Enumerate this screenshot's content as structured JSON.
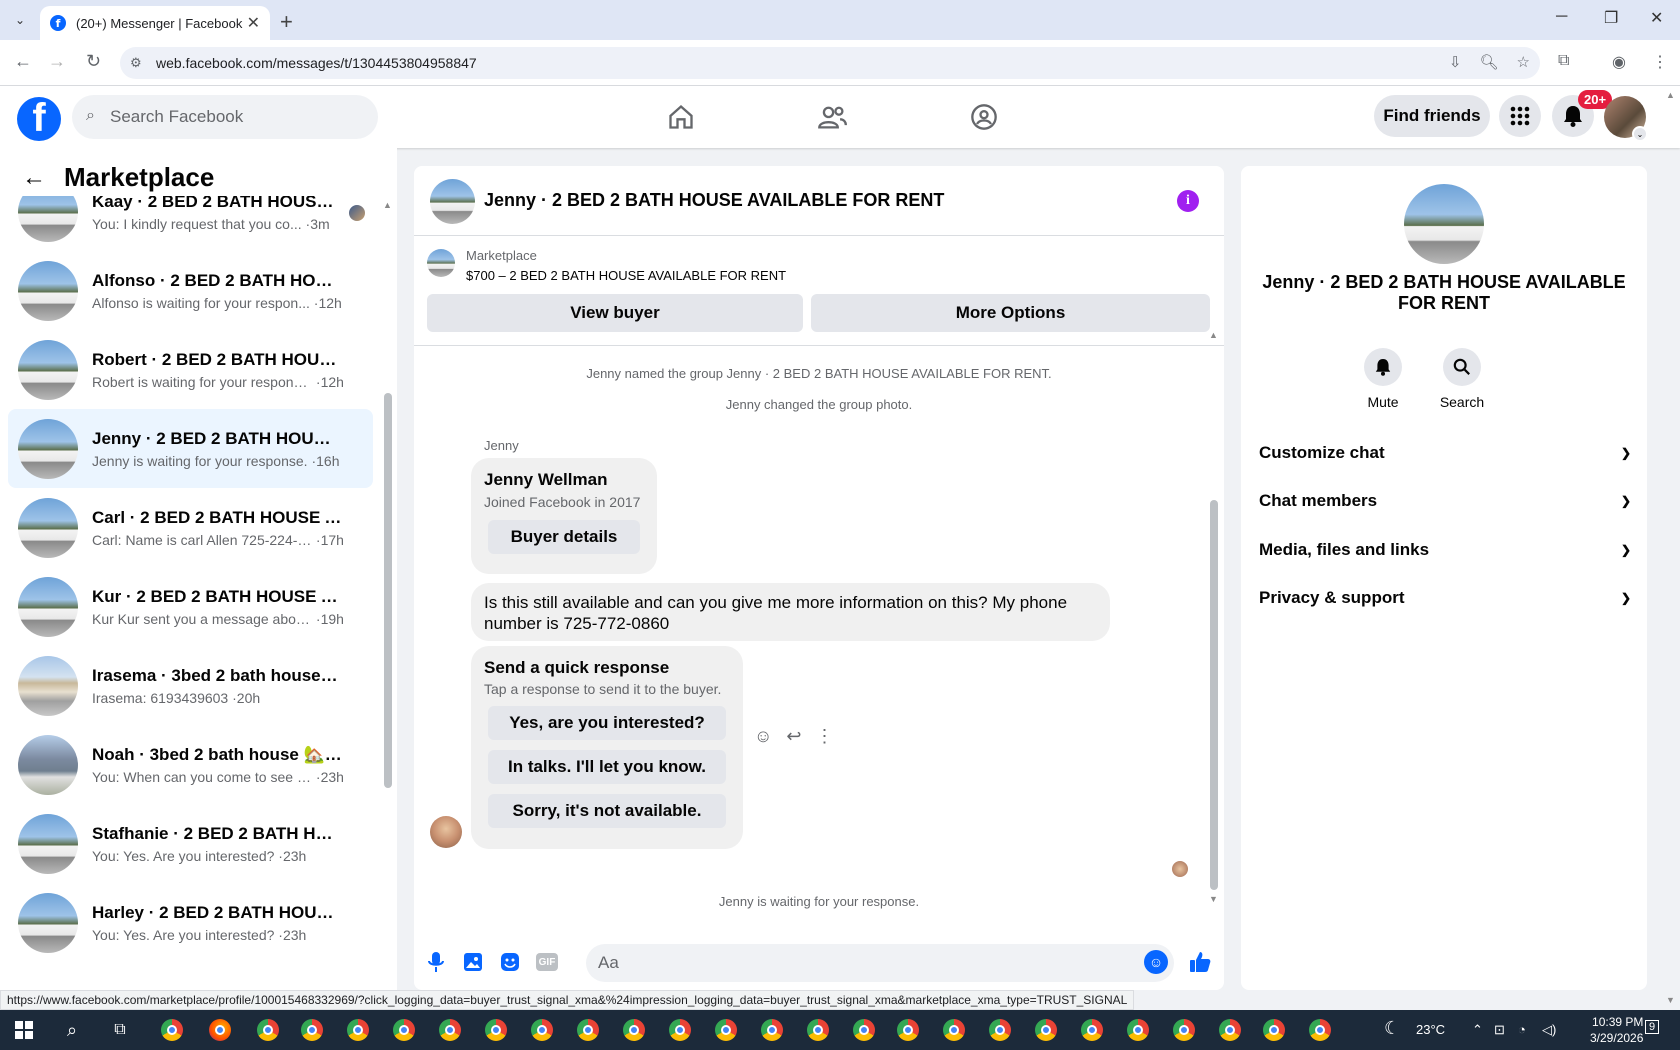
{
  "browser": {
    "tab_title": "(20+) Messenger | Facebook",
    "url": "web.facebook.com/messages/t/1304453804958847",
    "status_url": "https://www.facebook.com/marketplace/profile/100015468332969/?click_logging_data=buyer_trust_signal_xma&%24impression_logging_data=buyer_trust_signal_xma&marketplace_xma_type=TRUST_SIGNAL"
  },
  "header": {
    "search_placeholder": "Search Facebook",
    "find_friends": "Find friends",
    "notif_count": "20+"
  },
  "sidebar": {
    "title": "Marketplace",
    "conversations": [
      {
        "name": "Kaay · 2 BED 2 BATH HOUSE A...",
        "snippet": "You: I kindly request that you co...",
        "time": "3m",
        "img": "house"
      },
      {
        "name": "Alfonso · 2 BED 2 BATH HOUSE ...",
        "snippet": "Alfonso is waiting for your respon...",
        "time": "12h",
        "img": "house"
      },
      {
        "name": "Robert · 2 BED 2 BATH HOUSE A...",
        "snippet": "Robert is waiting for your response.",
        "time": "12h",
        "img": "house"
      },
      {
        "name": "Jenny · 2 BED 2 BATH HOUSE AV...",
        "snippet": "Jenny is waiting for your response.",
        "time": "16h",
        "img": "house"
      },
      {
        "name": "Carl · 2 BED 2 BATH HOUSE AVAI...",
        "snippet": "Carl: Name is carl Allen 725-224-1...",
        "time": "17h",
        "img": "house"
      },
      {
        "name": "Kur · 2 BED 2 BATH HOUSE AVAI...",
        "snippet": "Kur Kur sent you a message about...",
        "time": "19h",
        "img": "house"
      },
      {
        "name": "Irasema · 3bed 2 bath house 🏡 ...",
        "snippet": "Irasema: 6193439603",
        "time": "20h",
        "img": "alt"
      },
      {
        "name": "Noah · 3bed 2 bath house 🏡 for...",
        "snippet": "You: When can you come to see t...",
        "time": "23h",
        "img": "alt2"
      },
      {
        "name": "Stafhanie · 2 BED 2 BATH HOUS...",
        "snippet": "You: Yes. Are you interested?",
        "time": "23h",
        "img": "house"
      },
      {
        "name": "Harley · 2 BED 2 BATH HOUSE A...",
        "snippet": "You: Yes. Are you interested?",
        "time": "23h",
        "img": "house"
      }
    ]
  },
  "chat": {
    "title": "Jenny · 2 BED 2 BATH HOUSE AVAILABLE FOR RENT",
    "marketplace_label": "Marketplace",
    "listing": "$700 – 2 BED 2 BATH HOUSE AVAILABLE FOR RENT",
    "view_buyer": "View buyer",
    "more_options": "More Options",
    "sys_rename": "Jenny named the group Jenny · 2 BED 2 BATH HOUSE AVAILABLE FOR RENT.",
    "sys_photo": "Jenny changed the group photo.",
    "sender": "Jenny",
    "buyer_name": "Jenny Wellman",
    "buyer_joined": "Joined Facebook in 2017",
    "buyer_details": "Buyer details",
    "message": "Is this still available and can you give me more information on this? My phone number is 725-772-0860",
    "quick_title": "Send a quick response",
    "quick_sub": "Tap a response to send it to the buyer.",
    "quick_responses": [
      "Yes, are you interested?",
      "In talks. I'll let you know.",
      "Sorry, it's not available."
    ],
    "waiting": "Jenny is waiting for your response.",
    "composer_placeholder": "Aa"
  },
  "right_panel": {
    "title": "Jenny · 2 BED 2 BATH HOUSE AVAILABLE FOR RENT",
    "mute": "Mute",
    "search": "Search",
    "sections": [
      "Customize chat",
      "Chat members",
      "Media, files and links",
      "Privacy & support"
    ]
  },
  "taskbar": {
    "weather": "23°C",
    "time": "10:39 PM",
    "date": "3/29/2026",
    "notif": "9"
  }
}
